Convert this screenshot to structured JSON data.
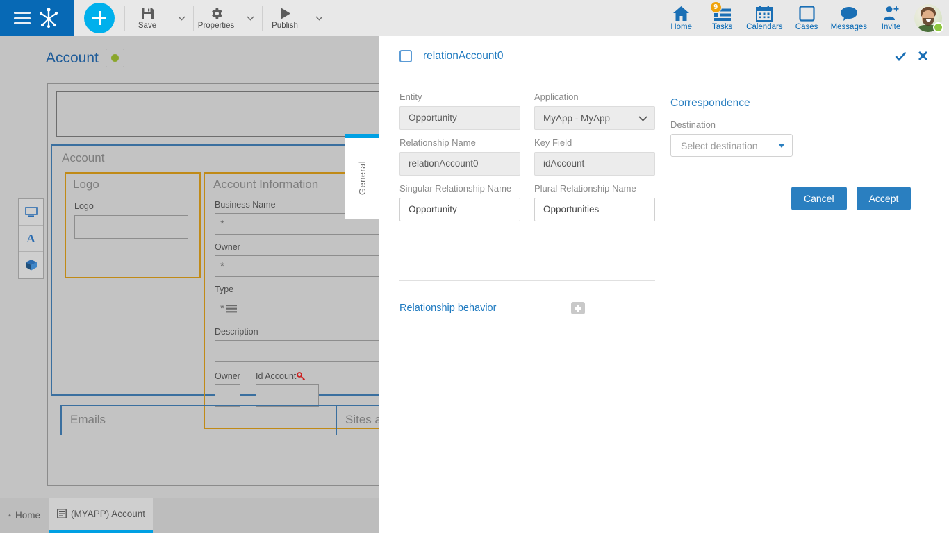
{
  "topbar": {
    "menu_icon": "hamburger-icon",
    "brand_icon": "frog-logo-icon",
    "add_label": "+",
    "tools": [
      {
        "label": "Save",
        "icon": "save-icon"
      },
      {
        "label": "Properties",
        "icon": "gear-icon"
      },
      {
        "label": "Publish",
        "icon": "play-icon"
      }
    ],
    "nav": [
      {
        "label": "Home",
        "icon": "home-icon",
        "badge": ""
      },
      {
        "label": "Tasks",
        "icon": "tasks-icon",
        "badge": "9"
      },
      {
        "label": "Calendars",
        "icon": "calendar-icon",
        "badge": ""
      },
      {
        "label": "Cases",
        "icon": "square-icon",
        "badge": ""
      },
      {
        "label": "Messages",
        "icon": "chat-bubble-icon",
        "badge": ""
      },
      {
        "label": "Invite",
        "icon": "person-add-icon",
        "badge": ""
      }
    ],
    "avatar": {
      "name": "avatar",
      "status": "online"
    }
  },
  "designer": {
    "entity_title": "Account",
    "status_icon": "green-dot-icon",
    "section_title": "Account",
    "logo_group_title": "Logo",
    "logo_field_label": "Logo",
    "info_group_title": "Account Information",
    "fields": [
      {
        "label": "Business Name",
        "marker": "*"
      },
      {
        "label": "Owner",
        "marker": "*"
      },
      {
        "label": "Type",
        "marker": "*"
      },
      {
        "label": "Description",
        "marker": ""
      }
    ],
    "small_fields": [
      {
        "label": "Owner"
      },
      {
        "label": "Id Account",
        "icon": "key-icon"
      }
    ],
    "tabs": [
      {
        "label": "Emails"
      },
      {
        "label": "Sites a"
      }
    ],
    "side_tab": "General",
    "tools": [
      {
        "name": "screen-tool",
        "icon": "monitor-icon"
      },
      {
        "name": "text-tool",
        "icon": "letter-a-icon"
      },
      {
        "name": "object-tool",
        "icon": "cube-icon"
      }
    ]
  },
  "taskbar": {
    "items": [
      {
        "label": "Home",
        "icon": "home-icon",
        "closable": false,
        "active": false
      },
      {
        "label": "(MYAPP) Account",
        "icon": "form-icon",
        "closable": true,
        "active": true
      }
    ],
    "close_glyph": "✖"
  },
  "dialog": {
    "checkbox_checked": false,
    "title": "relationAccount0",
    "confirm_icon": "check-icon",
    "close_icon": "close-icon",
    "fields": {
      "entity": {
        "label": "Entity",
        "value": "Opportunity",
        "readonly": true
      },
      "application": {
        "label": "Application",
        "value": "MyApp - MyApp",
        "options": [
          "MyApp - MyApp"
        ]
      },
      "relationship_name": {
        "label": "Relationship Name",
        "value": "relationAccount0",
        "readonly": true
      },
      "key_field": {
        "label": "Key Field",
        "value": "idAccount",
        "readonly": true
      },
      "singular_relationship_name": {
        "label": "Singular Relationship Name",
        "value": "Opportunity",
        "readonly": false
      },
      "plural_relationship_name": {
        "label": "Plural Relationship Name",
        "value": "Opportunities",
        "readonly": false
      }
    },
    "relationship_behavior": {
      "label": "Relationship behavior",
      "add_icon": "plus-icon"
    },
    "correspondence": {
      "title": "Correspondence",
      "destination_label": "Destination",
      "destination_placeholder": "Select destination",
      "destination_value": "",
      "cancel_label": "Cancel",
      "accept_label": "Accept"
    }
  },
  "colors": {
    "brand_blue": "#0769b5",
    "accent_cyan": "#00b0ec",
    "link_blue": "#1f7ac0",
    "badge_orange": "#f0a30a",
    "status_green": "#8cc63e",
    "gold_border": "#c08a17",
    "section_border": "#3a6f9f"
  }
}
